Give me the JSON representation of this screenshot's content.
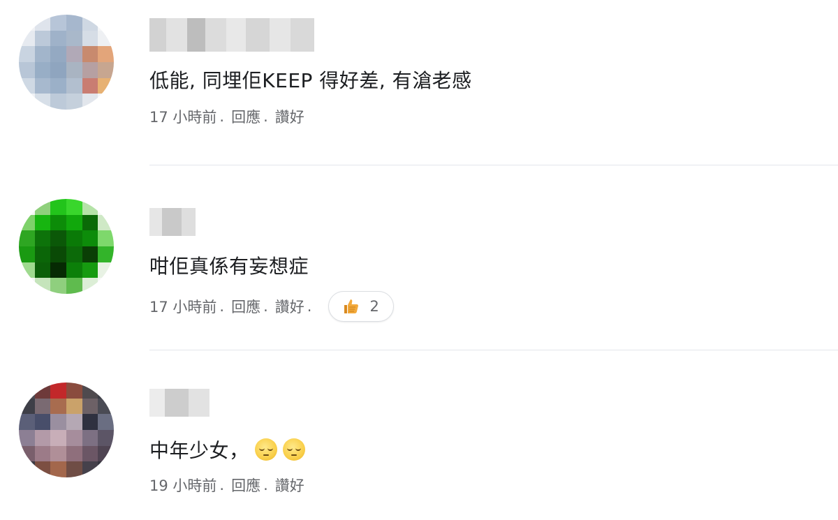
{
  "comments": [
    {
      "text": "低能, 同埋佢KEEP 得好差, 有滄老感",
      "time": "17 小時前",
      "reply_label": "回應",
      "like_label": "讚好",
      "separator": "."
    },
    {
      "text": "咁佢真係有妄想症",
      "time": "17 小時前",
      "reply_label": "回應",
      "like_label": "讚好",
      "separator": ".",
      "reaction": {
        "icon": "thumbs-up-icon",
        "count": "2"
      }
    },
    {
      "text": "中年少女，",
      "emojis": [
        "pensive-face-icon",
        "pensive-face-icon"
      ],
      "time": "19 小時前",
      "reply_label": "回應",
      "like_label": "讚好",
      "separator": "."
    }
  ],
  "colors": {
    "text": "#1c1e21",
    "meta": "#65676b",
    "divider": "#e4e6eb"
  }
}
